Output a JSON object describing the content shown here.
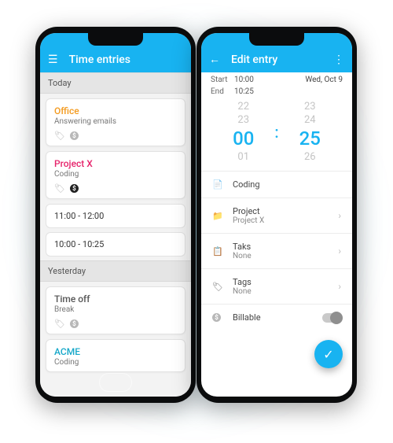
{
  "left": {
    "appbar": {
      "title": "Time entries"
    },
    "sections": {
      "today_label": "Today",
      "yesterday_label": "Yesterday"
    },
    "entries": {
      "office": {
        "project": "Office",
        "task": "Answering emails"
      },
      "projectx": {
        "project": "Project X",
        "task": "Coding",
        "slot1": "11:00 - 12:00",
        "slot2": "10:00 - 10:25"
      },
      "timeoff": {
        "project": "Time off",
        "task": "Break"
      },
      "acme": {
        "project": "ACME",
        "task": "Coding"
      }
    }
  },
  "right": {
    "appbar": {
      "title": "Edit entry"
    },
    "rows": {
      "start_label": "Start",
      "start_val": "10:00",
      "date": "Wed, Oct 9",
      "end_label": "End",
      "end_val": "10:25"
    },
    "picker": {
      "h_ghost_up": "22",
      "h_ghost_mid": "23",
      "h_sel": "00",
      "h_ghost_lo": "01",
      "m_ghost_up": "23",
      "m_ghost_mid": "24",
      "m_sel": "25",
      "m_ghost_lo": "26",
      "colon": ":"
    },
    "fields": {
      "description_val": "Coding",
      "project_label": "Project",
      "project_val": "Project X",
      "task_label": "Taks",
      "task_val": "None",
      "tags_label": "Tags",
      "tags_val": "None",
      "billable_label": "Billable"
    }
  },
  "glyphs": {
    "hamburger": "☰",
    "back": "←",
    "more": "⋮",
    "tag": "🏷",
    "dollar": "$",
    "doc": "📄",
    "folder": "📁",
    "clipboard": "📋",
    "check": "✓",
    "chev": "›"
  }
}
